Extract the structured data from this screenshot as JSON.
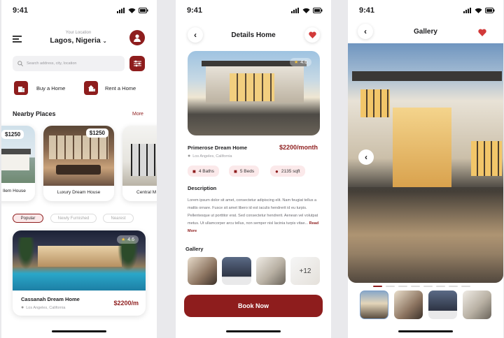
{
  "status": {
    "time": "9:41"
  },
  "home": {
    "location_label": "Your Location",
    "location_value": "Lagos, Nigeria",
    "search_placeholder": "Search address, city, location",
    "buy_label": "Buy a Home",
    "rent_label": "Rent a Home",
    "nearby_title": "Nearby Places",
    "more_label": "More",
    "nearby": [
      {
        "name": "Ilem House",
        "price": "$1250"
      },
      {
        "name": "Luxury Dream House",
        "price": "$1250"
      },
      {
        "name": "Central M",
        "price": ""
      }
    ],
    "filters": [
      "Popular",
      "Newly Furnished",
      "Nearest"
    ],
    "featured": {
      "name": "Cassanah Dream Home",
      "location": "Los Angeles, California",
      "price": "$2200/m",
      "rating": "4.6"
    }
  },
  "details": {
    "title": "Details Home",
    "rating": "4.6",
    "name": "Primerose Dream Home",
    "price": "$2200/month",
    "location": "Los Angeles, California",
    "amenities": [
      "4 Baths",
      "5 Beds",
      "2135 sqft"
    ],
    "description_title": "Description",
    "description": "Lorem ipsum dolor sit amet, consectetur adipiscing elit. Nam feugiat tellus a mattis ornare. Fusce sit amet libero id est iaculis hendrerit id eu turpis. Pellentesque ut porttitor erat. Sed consectetur hendrerit. Aenean vel volutpat metus. Ut ullamcorper arcu tellus, non semper nisl lacinia turpis vitae... ",
    "read_more": "Read More",
    "gallery_title": "Gallery",
    "gallery_more": "+12",
    "book_label": "Book Now"
  },
  "gallery": {
    "title": "Gallery"
  },
  "colors": {
    "brand": "#8e1d1d",
    "light": "#fbe9ea"
  }
}
